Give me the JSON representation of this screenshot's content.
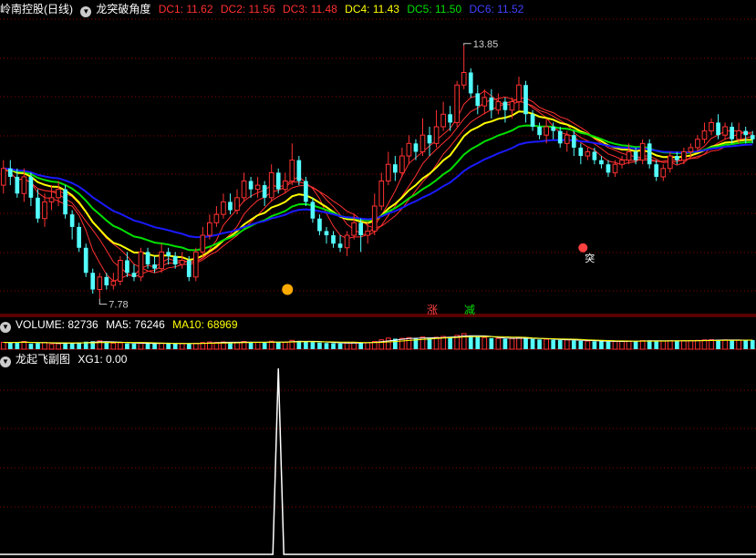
{
  "header": {
    "stock_name": "岭南控股(日线)",
    "indicator_name": "龙突破角度",
    "dc": [
      {
        "label": "DC1: 11.62",
        "color": "#ff3030"
      },
      {
        "label": "DC2: 11.56",
        "color": "#ff3030"
      },
      {
        "label": "DC3: 11.48",
        "color": "#ff3030"
      },
      {
        "label": "DC4: 11.43",
        "color": "#ffff00"
      },
      {
        "label": "DC5: 11.50",
        "color": "#00e000"
      },
      {
        "label": "DC6: 11.52",
        "color": "#2020ff"
      }
    ]
  },
  "volume_legend": {
    "volume": "VOLUME: 82736",
    "ma5": "MA5: 76246",
    "ma10": "MA10: 68969"
  },
  "sub_legend": {
    "name": "龙起飞副图",
    "xg1": "XG1: 0.00"
  },
  "annotations": {
    "high_label": "13.85",
    "low_label": "7.78",
    "tu_label": "突",
    "zhang": "涨",
    "jian": "减"
  },
  "colors": {
    "up": "#ff3232",
    "down": "#54ffff",
    "grid": "#8b0000",
    "yellow": "#ffff00",
    "green": "#00e000",
    "blue": "#1a1aff",
    "red_line": "#ff3030"
  },
  "chart_data": {
    "type": "candlestick",
    "title": "岭南控股(日线)",
    "price_range": [
      7.4,
      14.5
    ],
    "high_marker": {
      "index": 67,
      "value": 13.85
    },
    "low_marker": {
      "index": 14,
      "value": 7.78
    },
    "candles": [
      [
        10.5,
        10.9,
        11.1,
        10.3
      ],
      [
        10.9,
        10.7,
        11.1,
        10.5
      ],
      [
        10.7,
        10.3,
        10.9,
        10.2
      ],
      [
        10.3,
        10.7,
        10.9,
        10.1
      ],
      [
        10.7,
        10.2,
        10.8,
        10.0
      ],
      [
        10.2,
        9.7,
        10.4,
        9.6
      ],
      [
        9.7,
        10.1,
        10.3,
        9.5
      ],
      [
        10.1,
        10.2,
        10.5,
        9.9
      ],
      [
        10.2,
        10.4,
        10.6,
        10.0
      ],
      [
        10.4,
        9.8,
        10.5,
        9.7
      ],
      [
        9.8,
        9.5,
        9.9,
        9.2
      ],
      [
        9.5,
        9.0,
        9.6,
        8.9
      ],
      [
        9.0,
        8.4,
        9.1,
        8.3
      ],
      [
        8.4,
        8.0,
        8.5,
        7.9
      ],
      [
        8.0,
        8.3,
        8.4,
        7.78
      ],
      [
        8.3,
        8.1,
        8.4,
        8.0
      ],
      [
        8.1,
        8.2,
        8.4,
        8.0
      ],
      [
        8.2,
        8.7,
        8.8,
        8.1
      ],
      [
        8.7,
        8.4,
        8.9,
        8.3
      ],
      [
        8.4,
        8.3,
        8.6,
        8.2
      ],
      [
        8.3,
        8.9,
        9.0,
        8.2
      ],
      [
        8.9,
        8.6,
        9.0,
        8.5
      ],
      [
        8.6,
        8.5,
        8.8,
        8.4
      ],
      [
        8.5,
        8.9,
        9.1,
        8.4
      ],
      [
        8.9,
        8.8,
        9.0,
        8.6
      ],
      [
        8.8,
        8.6,
        8.9,
        8.5
      ],
      [
        8.6,
        8.7,
        8.9,
        8.5
      ],
      [
        8.7,
        8.3,
        8.8,
        8.2
      ],
      [
        8.3,
        8.9,
        9.0,
        8.2
      ],
      [
        8.9,
        9.3,
        9.5,
        8.8
      ],
      [
        9.3,
        9.6,
        9.8,
        9.2
      ],
      [
        9.6,
        9.8,
        10.0,
        9.5
      ],
      [
        9.8,
        10.1,
        10.3,
        9.7
      ],
      [
        10.1,
        9.9,
        10.3,
        9.8
      ],
      [
        9.9,
        10.2,
        10.4,
        9.8
      ],
      [
        10.2,
        10.6,
        10.8,
        10.1
      ],
      [
        10.6,
        10.4,
        10.7,
        10.2
      ],
      [
        10.4,
        10.5,
        10.7,
        10.2
      ],
      [
        10.5,
        10.2,
        10.6,
        10.0
      ],
      [
        10.2,
        10.8,
        11.0,
        10.1
      ],
      [
        10.8,
        10.4,
        10.9,
        10.3
      ],
      [
        10.4,
        10.6,
        10.8,
        10.3
      ],
      [
        10.6,
        11.1,
        11.5,
        10.5
      ],
      [
        11.1,
        10.6,
        11.2,
        10.5
      ],
      [
        10.6,
        10.1,
        10.7,
        10.0
      ],
      [
        10.1,
        9.7,
        10.2,
        9.6
      ],
      [
        9.7,
        9.4,
        9.8,
        9.3
      ],
      [
        9.4,
        9.3,
        9.5,
        9.1
      ],
      [
        9.3,
        9.1,
        9.4,
        9.0
      ],
      [
        9.1,
        9.0,
        9.3,
        8.9
      ],
      [
        9.0,
        9.3,
        9.4,
        8.8
      ],
      [
        9.3,
        9.6,
        9.8,
        9.2
      ],
      [
        9.6,
        9.3,
        9.7,
        8.9
      ],
      [
        9.3,
        9.4,
        9.6,
        9.1
      ],
      [
        9.4,
        10.0,
        10.3,
        9.3
      ],
      [
        10.0,
        10.6,
        10.8,
        9.9
      ],
      [
        10.6,
        11.0,
        11.3,
        10.5
      ],
      [
        11.0,
        10.8,
        11.2,
        10.6
      ],
      [
        10.8,
        11.2,
        11.4,
        10.7
      ],
      [
        11.2,
        11.5,
        11.7,
        11.0
      ],
      [
        11.5,
        11.3,
        11.6,
        11.1
      ],
      [
        11.3,
        11.7,
        12.1,
        11.2
      ],
      [
        11.7,
        11.5,
        11.9,
        11.2
      ],
      [
        11.5,
        11.9,
        12.3,
        11.4
      ],
      [
        11.9,
        12.2,
        12.5,
        11.8
      ],
      [
        12.2,
        12.0,
        12.4,
        11.8
      ],
      [
        12.0,
        12.9,
        13.0,
        11.9
      ],
      [
        12.9,
        13.2,
        13.85,
        12.8
      ],
      [
        13.2,
        12.7,
        13.3,
        12.6
      ],
      [
        12.7,
        12.4,
        12.9,
        12.2
      ],
      [
        12.4,
        12.6,
        12.8,
        12.2
      ],
      [
        12.6,
        12.3,
        12.8,
        12.1
      ],
      [
        12.3,
        12.5,
        12.7,
        12.2
      ],
      [
        12.5,
        12.3,
        12.6,
        12.0
      ],
      [
        12.3,
        12.5,
        12.6,
        12.1
      ],
      [
        12.5,
        12.9,
        13.1,
        12.3
      ],
      [
        12.9,
        12.2,
        13.0,
        12.0
      ],
      [
        12.2,
        11.9,
        12.3,
        11.8
      ],
      [
        11.9,
        11.7,
        12.0,
        11.6
      ],
      [
        11.7,
        11.9,
        12.1,
        11.5
      ],
      [
        11.9,
        11.8,
        12.0,
        11.6
      ],
      [
        11.8,
        11.5,
        11.9,
        11.4
      ],
      [
        11.5,
        11.7,
        11.8,
        11.3
      ],
      [
        11.7,
        11.4,
        11.8,
        11.2
      ],
      [
        11.4,
        11.2,
        11.5,
        11.0
      ],
      [
        11.2,
        11.3,
        11.4,
        11.1
      ],
      [
        11.3,
        11.1,
        11.4,
        11.0
      ],
      [
        11.1,
        11.0,
        11.2,
        10.9
      ],
      [
        11.0,
        10.8,
        11.1,
        10.7
      ],
      [
        10.8,
        11.0,
        11.1,
        10.7
      ],
      [
        11.0,
        11.1,
        11.2,
        10.9
      ],
      [
        11.1,
        11.3,
        11.5,
        11.0
      ],
      [
        11.3,
        11.1,
        11.4,
        11.0
      ],
      [
        11.1,
        11.5,
        11.6,
        11.0
      ],
      [
        11.5,
        11.0,
        11.6,
        10.9
      ],
      [
        11.0,
        10.7,
        11.1,
        10.6
      ],
      [
        10.7,
        10.9,
        11.0,
        10.6
      ],
      [
        10.9,
        11.2,
        11.3,
        10.8
      ],
      [
        11.2,
        11.1,
        11.3,
        11.0
      ],
      [
        11.1,
        11.3,
        11.4,
        11.0
      ],
      [
        11.3,
        11.4,
        11.5,
        11.2
      ],
      [
        11.4,
        11.6,
        11.7,
        11.3
      ],
      [
        11.6,
        11.8,
        12.0,
        11.5
      ],
      [
        11.8,
        12.0,
        12.1,
        11.7
      ],
      [
        12.0,
        11.7,
        12.2,
        11.6
      ],
      [
        11.7,
        11.9,
        12.0,
        11.6
      ],
      [
        11.9,
        11.6,
        12.0,
        11.5
      ],
      [
        11.6,
        11.8,
        12.0,
        11.5
      ],
      [
        11.8,
        11.7,
        11.9,
        11.5
      ],
      [
        11.7,
        11.6,
        11.8,
        11.5
      ]
    ],
    "volume": [
      62000,
      58000,
      65000,
      70000,
      52000,
      55000,
      60000,
      48000,
      50000,
      54000,
      58000,
      62000,
      68000,
      72000,
      75000,
      60000,
      55000,
      58000,
      52000,
      50000,
      56000,
      53000,
      49000,
      55000,
      52000,
      50000,
      51000,
      48000,
      54000,
      60000,
      65000,
      62000,
      66000,
      58000,
      61000,
      70000,
      64000,
      62000,
      58000,
      72000,
      66000,
      63000,
      80000,
      75000,
      70000,
      65000,
      60000,
      56000,
      54000,
      52000,
      58000,
      62000,
      60000,
      59000,
      70000,
      85000,
      100000,
      95000,
      98000,
      105000,
      96000,
      110000,
      100000,
      108000,
      115000,
      110000,
      125000,
      140000,
      120000,
      110000,
      105000,
      100000,
      98000,
      95000,
      96000,
      105000,
      100000,
      92000,
      88000,
      90000,
      85000,
      82000,
      84000,
      80000,
      76000,
      74000,
      72000,
      70000,
      68000,
      70000,
      72000,
      75000,
      74000,
      78000,
      80000,
      76000,
      74000,
      76000,
      75000,
      77000,
      78000,
      80000,
      84000,
      86000,
      82000,
      84000,
      80000,
      82000,
      81000,
      82736
    ],
    "xg1_signal": {
      "index": 40,
      "value": 1.0
    }
  }
}
